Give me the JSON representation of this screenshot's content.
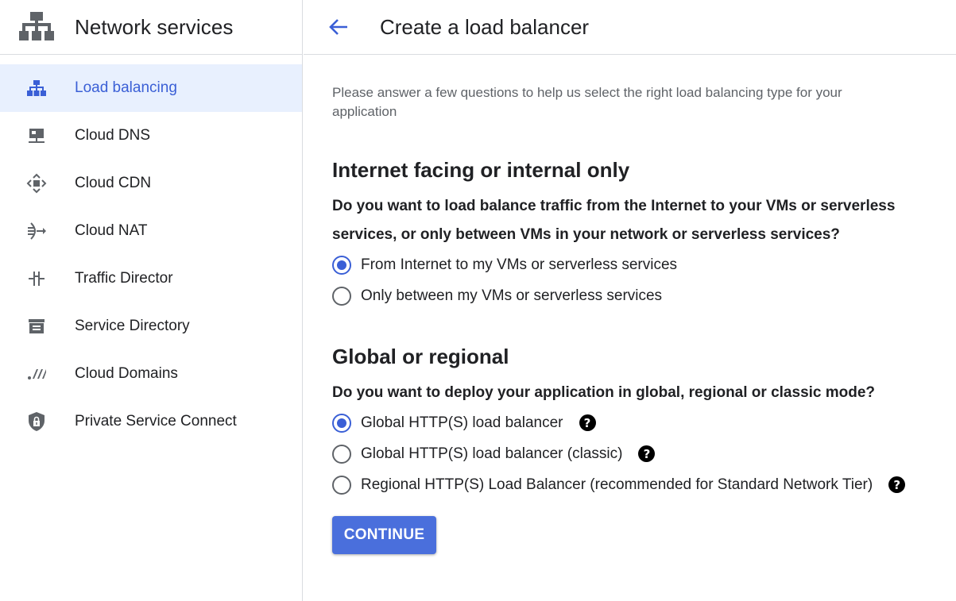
{
  "sidebar": {
    "title": "Network services",
    "items": [
      {
        "label": "Load balancing",
        "icon": "load-balancing-icon",
        "active": true
      },
      {
        "label": "Cloud DNS",
        "icon": "dns-icon",
        "active": false
      },
      {
        "label": "Cloud CDN",
        "icon": "cdn-icon",
        "active": false
      },
      {
        "label": "Cloud NAT",
        "icon": "nat-icon",
        "active": false
      },
      {
        "label": "Traffic Director",
        "icon": "traffic-director-icon",
        "active": false
      },
      {
        "label": "Service Directory",
        "icon": "service-directory-icon",
        "active": false
      },
      {
        "label": "Cloud Domains",
        "icon": "domains-icon",
        "active": false
      },
      {
        "label": "Private Service Connect",
        "icon": "shield-lock-icon",
        "active": false
      }
    ]
  },
  "header": {
    "back_icon": "arrow-back-icon",
    "title": "Create a load balancer"
  },
  "content": {
    "intro": "Please answer a few questions to help us select the right load balancing type for your application",
    "section1": {
      "title": "Internet facing or internal only",
      "question": "Do you want to load balance traffic from the Internet to your VMs or serverless services, or only between VMs in your network or serverless services?",
      "options": [
        {
          "label": "From Internet to my VMs or serverless services",
          "selected": true
        },
        {
          "label": "Only between my VMs or serverless services",
          "selected": false
        }
      ]
    },
    "section2": {
      "title": "Global or regional",
      "question": "Do you want to deploy your application in global, regional or classic mode?",
      "options": [
        {
          "label": "Global HTTP(S) load balancer",
          "selected": true,
          "help": "?"
        },
        {
          "label": "Global HTTP(S) load balancer (classic)",
          "selected": false,
          "help": "?"
        },
        {
          "label": "Regional HTTP(S) Load Balancer (recommended for Standard Network Tier)",
          "selected": false,
          "help": "?"
        }
      ]
    },
    "continue_label": "CONTINUE"
  },
  "colors": {
    "accent": "#3a5fd6",
    "button": "#4a6fdc",
    "active_bg": "#e8f0fe",
    "icon_gray": "#5f6368"
  }
}
